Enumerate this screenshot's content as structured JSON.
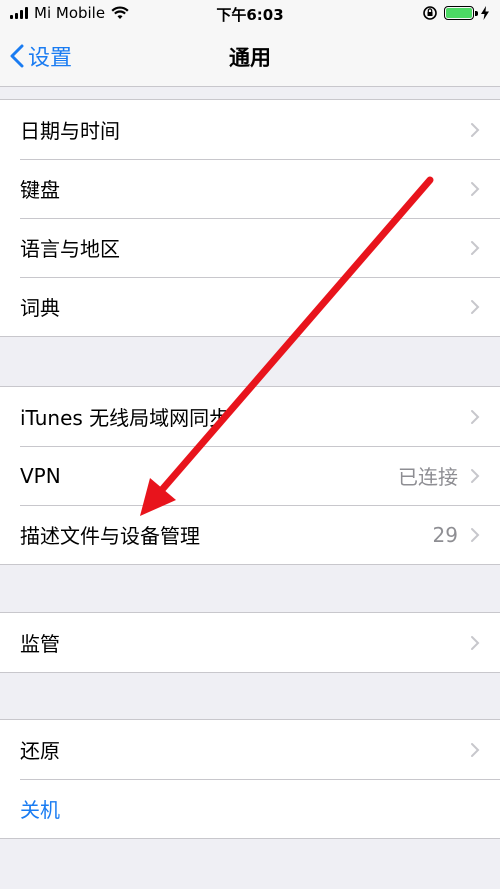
{
  "status_bar": {
    "carrier": "Mi Mobile",
    "time": "下午6:03",
    "signal_bars": 4,
    "battery_level": 1.0,
    "battery_color": "#4cd964",
    "icons": [
      "signal-icon",
      "wifi-icon",
      "orientation-lock-icon",
      "battery-icon",
      "charging-icon"
    ]
  },
  "nav": {
    "back_label": "设置",
    "title": "通用"
  },
  "groups": [
    {
      "rows": [
        {
          "label": "日期与时间",
          "value": "",
          "chevron": true
        },
        {
          "label": "键盘",
          "value": "",
          "chevron": true
        },
        {
          "label": "语言与地区",
          "value": "",
          "chevron": true
        },
        {
          "label": "词典",
          "value": "",
          "chevron": true
        }
      ]
    },
    {
      "rows": [
        {
          "label": "iTunes 无线局域网同步",
          "value": "",
          "chevron": true
        },
        {
          "label": "VPN",
          "value": "已连接",
          "chevron": true
        },
        {
          "label": "描述文件与设备管理",
          "value": "29",
          "chevron": true
        }
      ]
    },
    {
      "rows": [
        {
          "label": "监管",
          "value": "",
          "chevron": true
        }
      ]
    },
    {
      "rows": [
        {
          "label": "还原",
          "value": "",
          "chevron": true
        },
        {
          "label": "关机",
          "value": "",
          "chevron": false
        }
      ]
    }
  ],
  "colors": {
    "accent": "#1a7cf2",
    "annotation_arrow": "#e8141c",
    "background": "#efeff4"
  }
}
